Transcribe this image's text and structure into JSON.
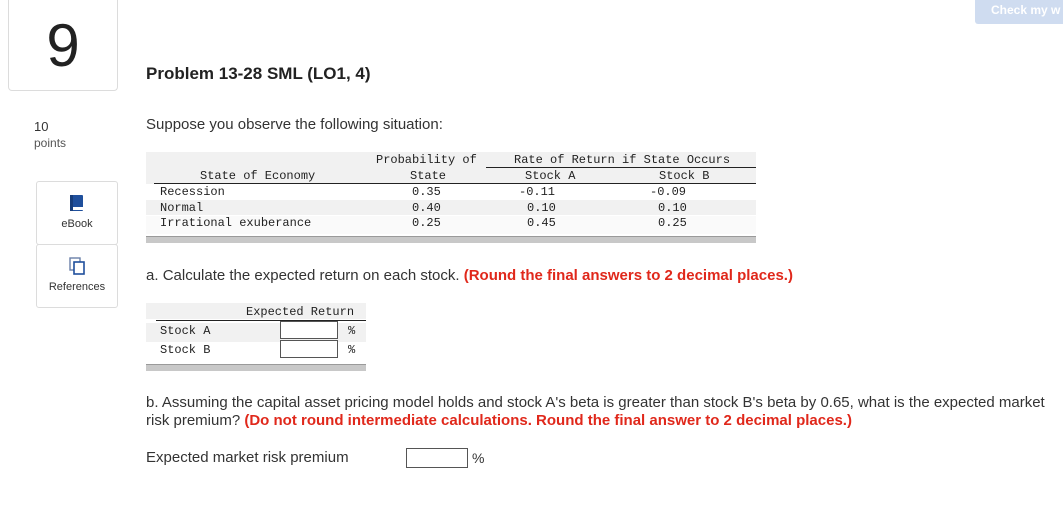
{
  "question": {
    "number": "9",
    "title": "Problem 13-28 SML (LO1, 4)",
    "points_value": "10",
    "points_label": "points",
    "check_button": "Check my w"
  },
  "sidebar": {
    "ebook_label": "eBook",
    "references_label": "References"
  },
  "prompt": "Suppose you observe the following situation:",
  "table": {
    "headers": {
      "state_of_economy": "State of Economy",
      "probability_line1": "Probability of",
      "probability_line2": "State",
      "rate_group": "Rate of Return if State Occurs",
      "stock_a": "Stock A",
      "stock_b": "Stock B"
    },
    "rows": [
      {
        "state": "Recession",
        "prob": "0.35",
        "a": "-0.11",
        "b": "-0.09"
      },
      {
        "state": "Normal",
        "prob": "0.40",
        "a": "0.10",
        "b": "0.10"
      },
      {
        "state": "Irrational exuberance",
        "prob": "0.25",
        "a": "0.45",
        "b": "0.25"
      }
    ]
  },
  "part_a": {
    "label": "a.",
    "text": "Calculate the expected return on each stock.",
    "instruction": "(Round the final answers to 2 decimal places.)",
    "header": "Expected Return",
    "rows": [
      {
        "label": "Stock A",
        "value": "",
        "unit": "%"
      },
      {
        "label": "Stock B",
        "value": "",
        "unit": "%"
      }
    ]
  },
  "part_b": {
    "label": "b.",
    "text": "Assuming the capital asset pricing model holds and stock A's beta is greater than stock B's beta by 0.65, what is the expected market risk premium?",
    "instruction": "(Do not round intermediate calculations. Round the final answer to 2 decimal places.)",
    "field_label": "Expected market risk premium",
    "field_value": "",
    "unit": "%"
  }
}
